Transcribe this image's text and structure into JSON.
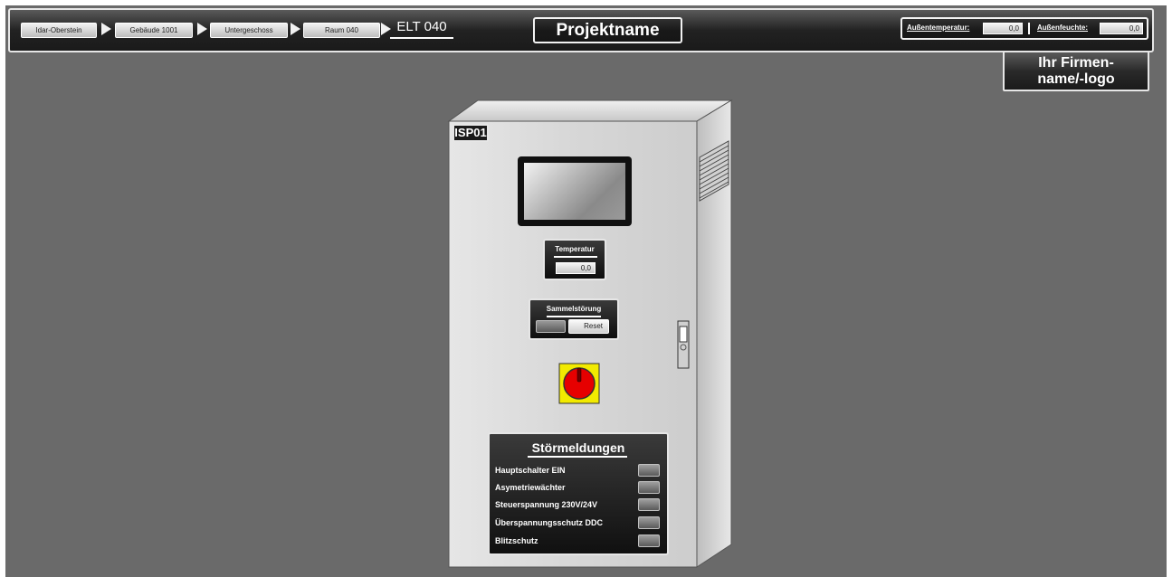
{
  "header": {
    "breadcrumbs": [
      "Idar-Oberstein",
      "Gebäude 1001",
      "Untergeschoss",
      "Raum 040"
    ],
    "current": "ELT 040",
    "project_name": "Projektname",
    "outdoor_temp_label": "Außentemperatur:",
    "outdoor_temp_value": "0,0",
    "outdoor_humidity_label": "Außenfeuchte:",
    "outdoor_humidity_value": "0,0"
  },
  "company": {
    "line1": "Ihr Firmen-",
    "line2": "name/-logo"
  },
  "cabinet": {
    "id": "ISP01",
    "temperature": {
      "label": "Temperatur",
      "value": "0,0"
    },
    "collective_fault": {
      "label": "Sammelstörung",
      "reset_label": "Reset"
    },
    "faults": {
      "title": "Störmeldungen",
      "items": [
        {
          "label": "Hauptschalter EIN"
        },
        {
          "label": "Asymetriewächter"
        },
        {
          "label": "Steuerspannung 230V/24V"
        },
        {
          "label": "Überspannungsschutz DDC"
        },
        {
          "label": "Blitzschutz"
        }
      ]
    }
  },
  "colors": {
    "background": "#6a6a6a",
    "cabinet": "#d9d9d9",
    "switch_yellow": "#f2ea00",
    "switch_red": "#e60000"
  }
}
